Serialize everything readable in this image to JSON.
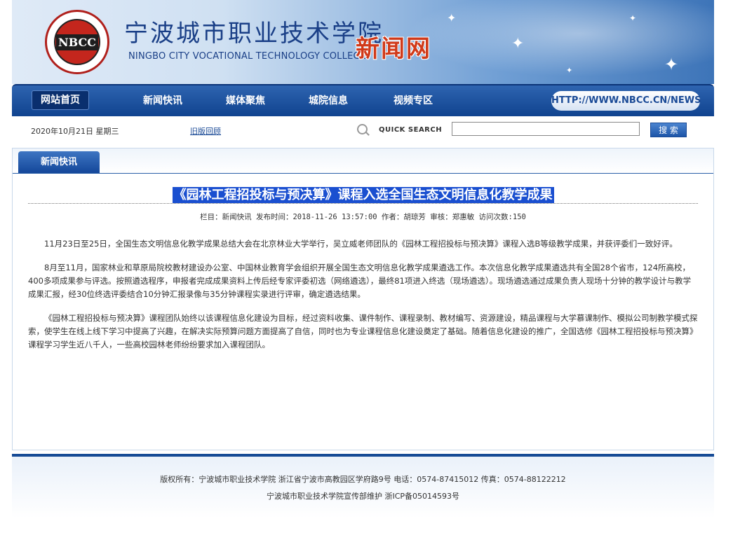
{
  "header": {
    "school_cn": "宁波城市职业技术学院",
    "school_en": "NINGBO CITY VOCATIONAL TECHNOLOGY COLLEGE",
    "site_name": "新闻网",
    "logo_text": "NBCC"
  },
  "nav": {
    "items": [
      {
        "label": "网站首页",
        "active": true
      },
      {
        "label": "新闻快讯"
      },
      {
        "label": "媒体聚焦"
      },
      {
        "label": "城院信息"
      },
      {
        "label": "视频专区"
      }
    ],
    "url": "HTTP://WWW.NBCC.CN/NEWS"
  },
  "infobar": {
    "date": "2020年10月21日 星期三",
    "old_version": "旧版回顾",
    "quick_search": "QUICK SEARCH",
    "search_placeholder": "",
    "search_button": "搜 索"
  },
  "section_tab": "新闻快讯",
  "article": {
    "title": "《园林工程招投标与预决算》课程入选全国生态文明信息化教学成果",
    "meta": "栏目：新闻快讯   发布时间：2018-11-26 13:57:00   作者：胡琼芳 审核：郑惠敏  访问次数:150",
    "paragraphs": [
      "11月23日至25日，全国生态文明信息化教学成果总结大会在北京林业大学举行，吴立威老师团队的《园林工程招投标与预决算》课程入选B等级教学成果，并获评委们一致好评。",
      "8月至11月，国家林业和草原局院校教材建设办公室、中国林业教育学会组织开展全国生态文明信息化教学成果遴选工作。本次信息化教学成果遴选共有全国28个省市，124所高校，400多项成果参与评选。按照遴选程序，申报者完成成果资料上传后经专家评委初选（网络遴选），最终81项进入终选（现场遴选）。现场遴选通过成果负责人现场十分钟的教学设计与教学成果汇报，经30位终选评委结合10分钟汇报录像与35分钟课程实录进行评审，确定遴选结果。",
      "《园林工程招投标与预决算》课程团队始终以该课程信息化建设为目标，经过资料收集、课件制作、课程录制、教材编写、资源建设，精品课程与大学慕课制作、模拟公司制教学模式探索，使学生在线上线下学习中提高了兴趣，在解决实际预算问题方面提高了自信，同时也为专业课程信息化建设奠定了基础。随着信息化建设的推广，全国选修《园林工程招投标与预决算》课程学习学生近八千人，一些高校园林老师纷纷要求加入课程团队。"
    ]
  },
  "footer": {
    "line1": "版权所有：宁波城市职业技术学院 浙江省宁波市高教园区学府路9号 电话：0574-87415012 传真：0574-88122212",
    "line2": "宁波城市职业技术学院宣传部维护 浙ICP备05014593号"
  },
  "colors": {
    "nav_blue": "#10438f",
    "title_highlight": "#1a4fd0",
    "site_name_red": "#d03a1a"
  }
}
